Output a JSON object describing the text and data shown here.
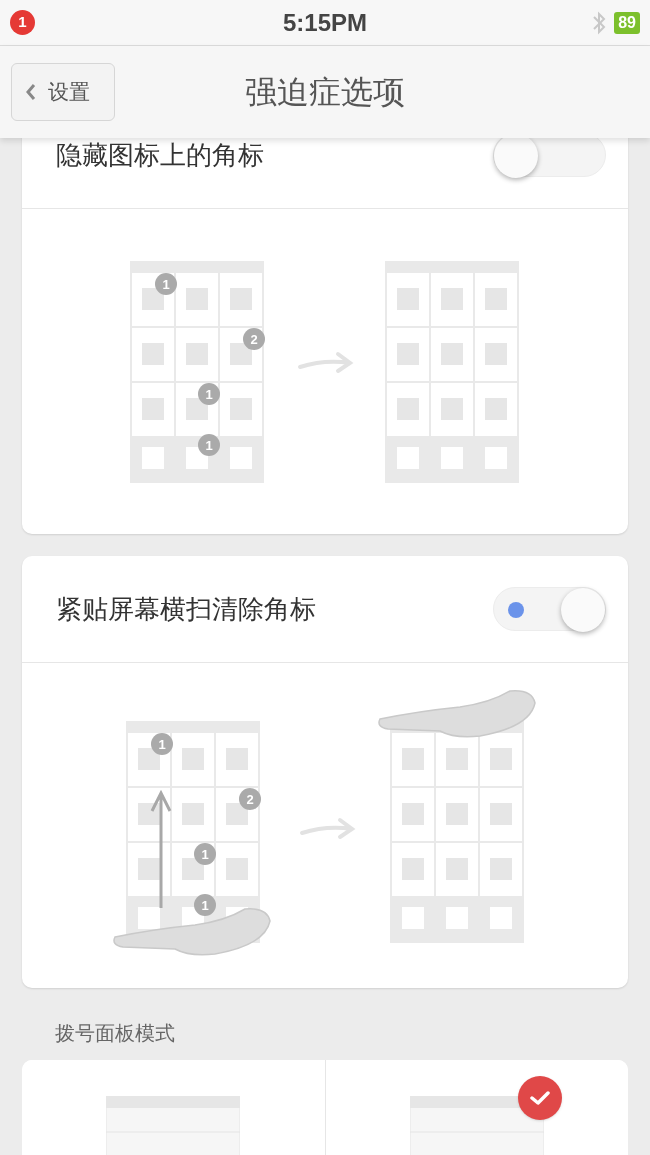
{
  "status_bar": {
    "notification_count": "1",
    "time": "5:15PM",
    "battery": "89"
  },
  "nav": {
    "back_label": "设置",
    "title": "强迫症选项"
  },
  "options": [
    {
      "kind": "badges",
      "label": "隐藏图标上的角标",
      "on": false,
      "badges": [
        "1",
        "2",
        "1",
        "1"
      ]
    },
    {
      "kind": "swipe",
      "label": "紧贴屏幕横扫清除角标",
      "on": true,
      "badges": [
        "1",
        "2",
        "1",
        "1"
      ]
    }
  ],
  "dial_pad": {
    "label": "拨号面板模式",
    "modes": [
      {
        "selected": false
      },
      {
        "selected": true
      }
    ]
  }
}
